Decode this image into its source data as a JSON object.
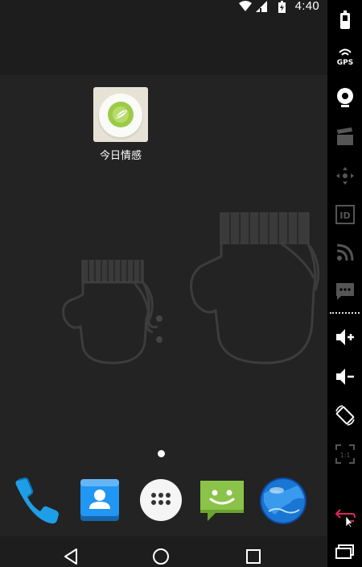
{
  "status_bar": {
    "time": "4:40",
    "icons": [
      "wifi-icon",
      "signal-icon",
      "battery-charging-icon"
    ]
  },
  "home": {
    "app_shortcut": {
      "label": "今日情感",
      "icon": "green-leaf-plate-icon"
    },
    "page_indicator": {
      "pages": 1,
      "current": 1
    },
    "dock": [
      {
        "name": "phone",
        "icon": "phone-icon"
      },
      {
        "name": "contacts",
        "icon": "contacts-icon"
      },
      {
        "name": "app-drawer",
        "icon": "app-drawer-icon"
      },
      {
        "name": "messaging",
        "icon": "messaging-icon"
      },
      {
        "name": "browser",
        "icon": "globe-icon"
      }
    ]
  },
  "nav_bar": {
    "buttons": [
      "back-icon",
      "home-icon",
      "recents-icon"
    ]
  },
  "emulator_toolbar": {
    "gps_label": "GPS",
    "id_label": "ID",
    "scale_label": "1:1",
    "buttons": [
      "battery-icon",
      "gps-icon",
      "camera-icon",
      "movie-clapper-icon",
      "dpad-icon",
      "id-icon",
      "rss-icon",
      "sms-icon",
      "volume-up-icon",
      "volume-down-icon",
      "rotate-icon",
      "scale-icon",
      "back-arrow-icon",
      "recents-icon"
    ],
    "colors": {
      "active": "#ffffff",
      "inactive": "#555555",
      "accent": "#e0245e"
    }
  }
}
